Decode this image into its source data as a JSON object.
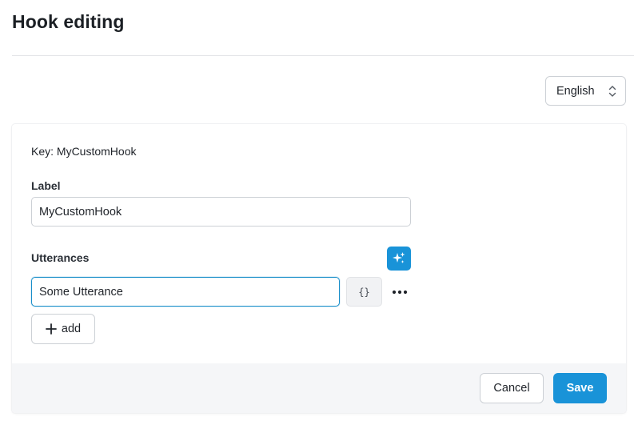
{
  "page": {
    "title": "Hook editing"
  },
  "language_select": {
    "value": "English",
    "icon": "chevron-up-down-icon"
  },
  "form": {
    "key_line": "Key: MyCustomHook",
    "label": {
      "title": "Label",
      "value": "MyCustomHook"
    },
    "utterances": {
      "title": "Utterances",
      "ai_icon": "sparkles-icon",
      "items": [
        {
          "value": "Some Utterance",
          "braces_label": "{}",
          "more_icon": "ellipsis-icon"
        }
      ],
      "add_label": "add",
      "add_icon": "plus-icon"
    }
  },
  "footer": {
    "cancel_label": "Cancel",
    "save_label": "Save"
  },
  "colors": {
    "accent": "#1993d8",
    "focus_border": "#1a8fc9",
    "footer_bg": "#f5f6f8"
  }
}
